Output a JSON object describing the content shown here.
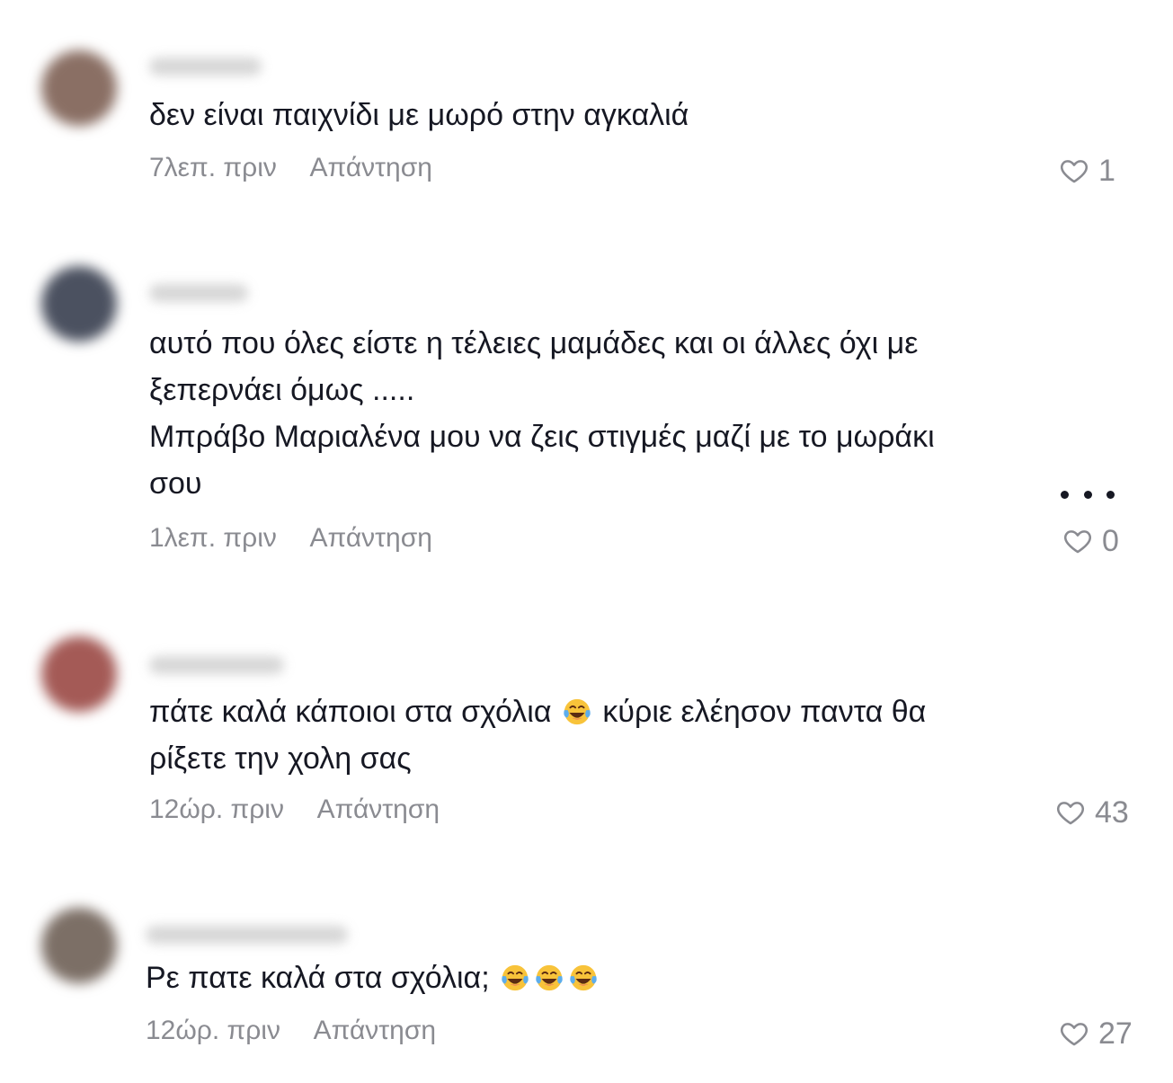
{
  "comments": [
    {
      "lines": [
        "δεν είναι παιχνίδι με μωρό στην αγκαλιά"
      ],
      "time": "7λεπ. πριν",
      "reply": "Απάντηση",
      "likes": "1",
      "avatar_color": "#8a6f64"
    },
    {
      "lines": [
        "αυτό που όλες είστε η τέλειες μαμάδες και οι άλλες όχι με",
        "ξεπερνάει όμως .....",
        "Μπράβο Μαριαλένα μου να ζεις στιγμές μαζί με το μωράκι",
        "σου"
      ],
      "time": "1λεπ. πριν",
      "reply": "Απάντηση",
      "likes": "0",
      "avatar_color": "#4b5160",
      "has_more_menu": true,
      "more_icon": "more-horizontal-icon"
    },
    {
      "line1_before_emoji": "πάτε καλά κάποιοι στα σχόλια ",
      "line1_after_emoji": " κύριε ελέησον παντα θα",
      "line2": "ρίξετε την χολη σας",
      "time": "12ώρ. πριν",
      "reply": "Απάντηση",
      "likes": "43",
      "avatar_color": "#a45a56",
      "emoji": "face-with-tears-of-joy"
    },
    {
      "text": "Ρε πατε καλά στα σχόλια; ",
      "time": "12ώρ. πριν",
      "reply": "Απάντηση",
      "likes": "27",
      "avatar_color": "#7c6f66",
      "emoji_count": 3,
      "emoji": "face-with-tears-of-joy"
    }
  ],
  "icons": {
    "like": "heart-outline-icon",
    "avatar": "blurred-avatar"
  },
  "colors": {
    "text": "#161823",
    "meta": "#8a8b91",
    "background": "#ffffff"
  }
}
